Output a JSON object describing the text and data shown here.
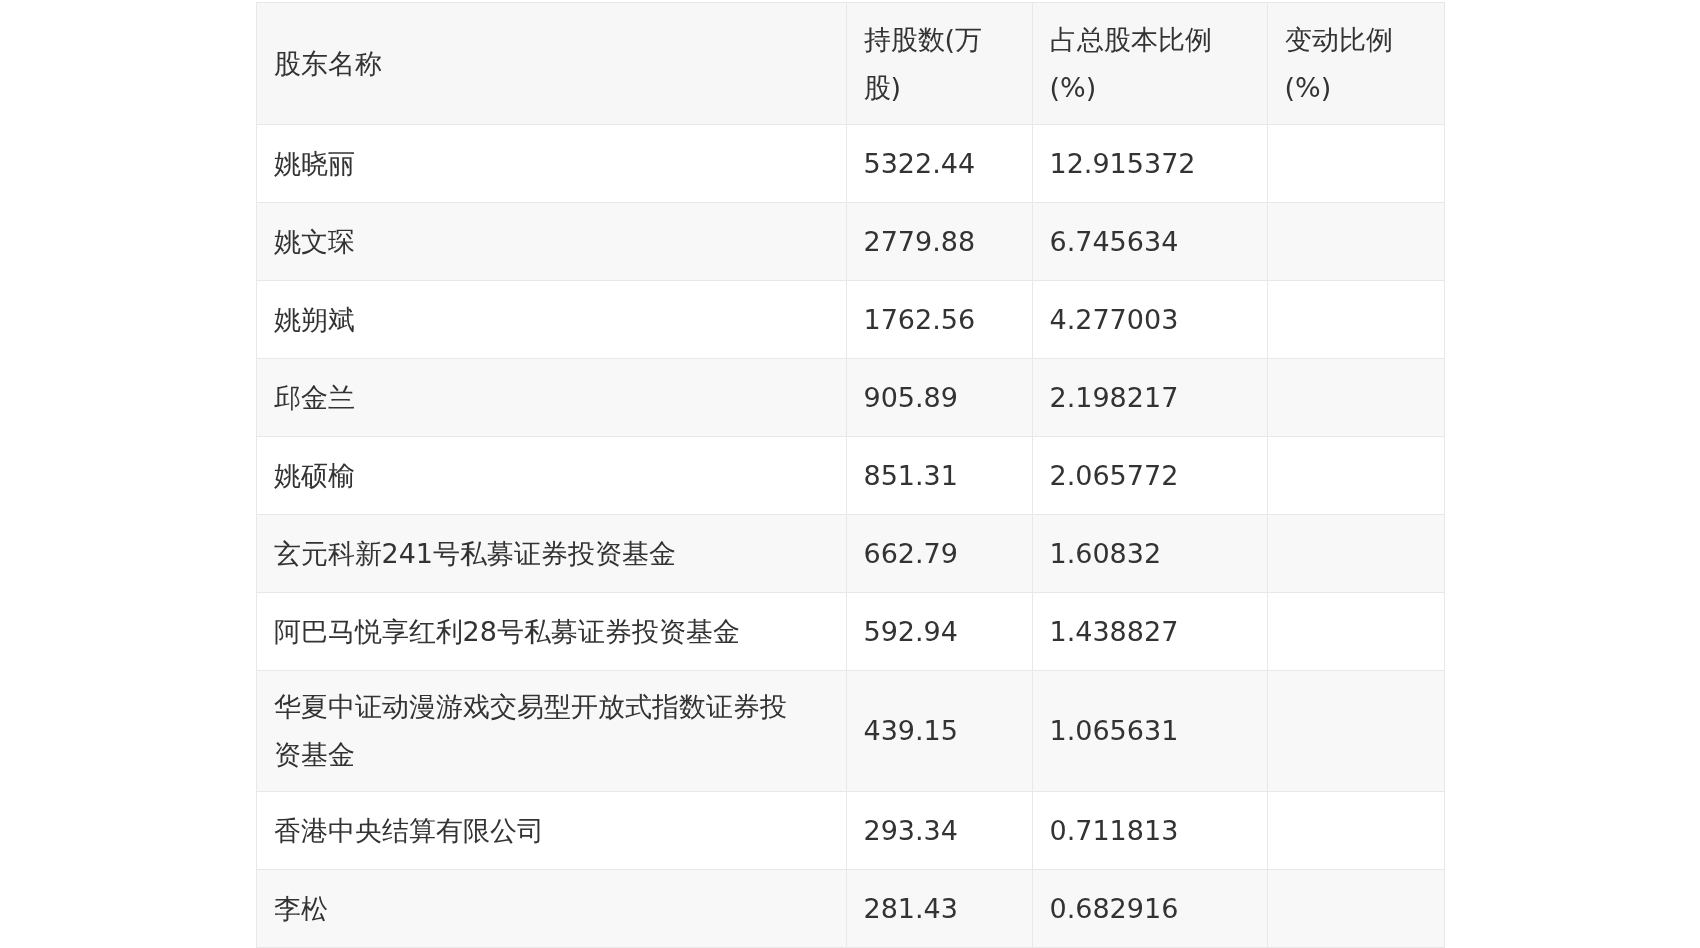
{
  "table": {
    "columns": [
      "股东名称",
      "持股数(万股)",
      "占总股本比例(%)",
      "变动比例(%)"
    ],
    "rows": [
      {
        "name": "姚晓丽",
        "shares": "5322.44",
        "ratio": "12.915372"
      },
      {
        "name": "姚文琛",
        "shares": "2779.88",
        "ratio": "6.745634"
      },
      {
        "name": "姚朔斌",
        "shares": "1762.56",
        "ratio": "4.277003"
      },
      {
        "name": "邱金兰",
        "shares": "905.89",
        "ratio": "2.198217"
      },
      {
        "name": "姚硕榆",
        "shares": "851.31",
        "ratio": "2.065772"
      },
      {
        "name": "玄元科新241号私募证券投资基金",
        "shares": "662.79",
        "ratio": "1.60832"
      },
      {
        "name": "阿巴马悦享红利28号私募证券投资基金",
        "shares": "592.94",
        "ratio": "1.438827"
      },
      {
        "name": "华夏中证动漫游戏交易型开放式指数证券投资基金",
        "shares": "439.15",
        "ratio": "1.065631"
      },
      {
        "name": "香港中央结算有限公司",
        "shares": "293.34",
        "ratio": "0.711813"
      },
      {
        "name": "李松",
        "shares": "281.43",
        "ratio": "0.682916"
      }
    ]
  }
}
